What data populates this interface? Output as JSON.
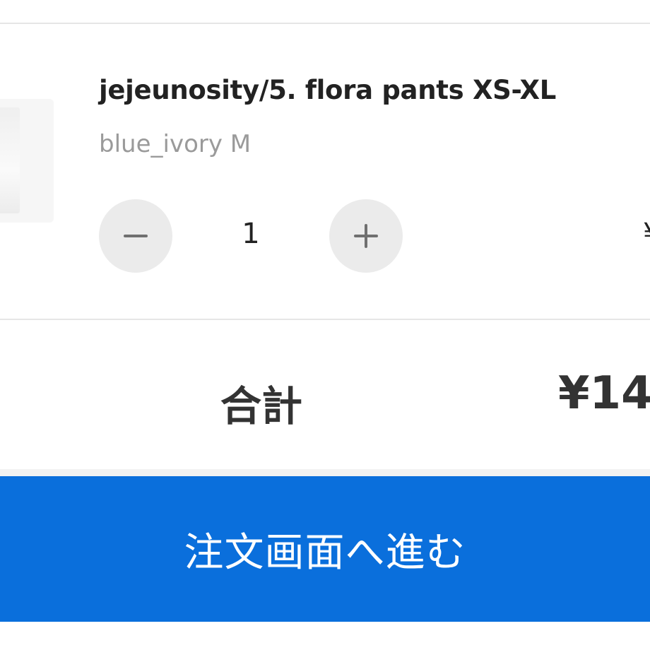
{
  "cart_item": {
    "title": "jejeunosity/5. flora pants XS-XL",
    "variant": "blue_ivory M",
    "thumbnail_icon": "product-thumbnail",
    "quantity": "1",
    "line_price": "¥",
    "minus_icon": "minus-icon",
    "plus_icon": "plus-icon"
  },
  "summary": {
    "total_label": "合計",
    "total_value": "¥14"
  },
  "checkout": {
    "button_label": "注文画面へ進む",
    "accent_color": "#0a6fdc"
  }
}
